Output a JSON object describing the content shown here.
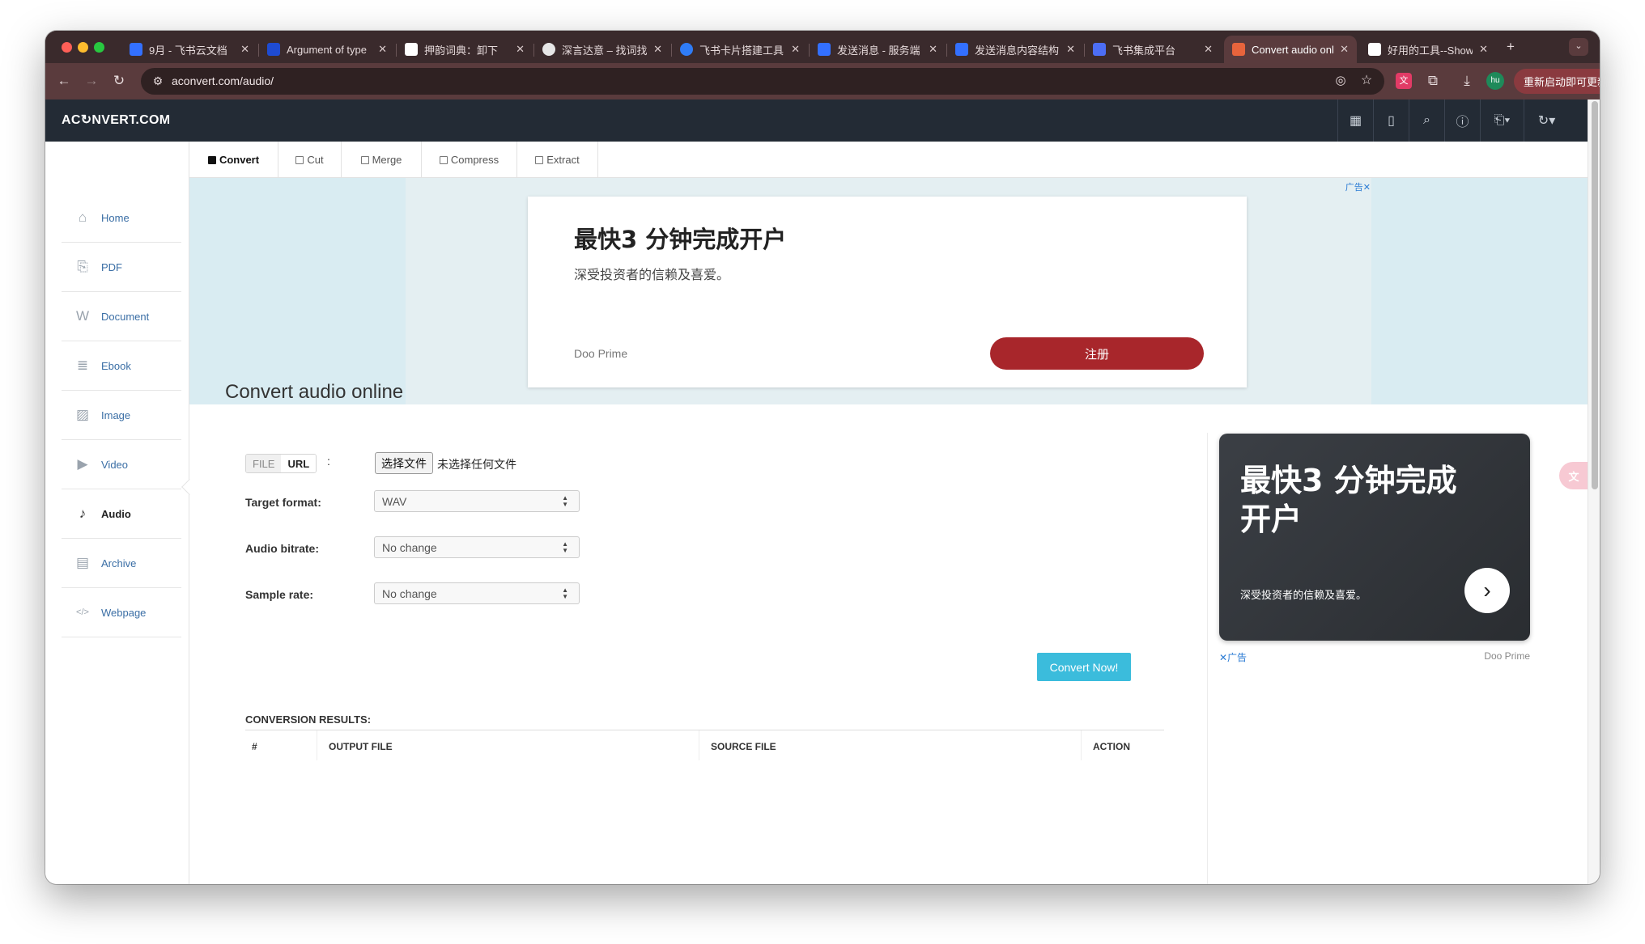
{
  "browser": {
    "tabs": [
      {
        "title": "9月 - 飞书云文档",
        "fav": "#3370ff"
      },
      {
        "title": "Argument of type",
        "fav": "#1e4bd2"
      },
      {
        "title": "押韵词典：卸下",
        "fav": "#ffffff"
      },
      {
        "title": "深言达意 – 找词找",
        "fav": "#e6e6e6"
      },
      {
        "title": "飞书卡片搭建工具",
        "fav": "#2f7cf6"
      },
      {
        "title": "发送消息 - 服务端",
        "fav": "#3370ff"
      },
      {
        "title": "发送消息内容结构",
        "fav": "#3370ff"
      },
      {
        "title": "飞书集成平台",
        "fav": "#4c6ef5"
      },
      {
        "title": "Convert audio onl",
        "fav": "#e8643c"
      },
      {
        "title": "好用的工具--Show",
        "fav": "#ffffff"
      }
    ],
    "url": "aconvert.com/audio/",
    "profile_initials": "hu",
    "restart_label": "重新启动即可更新"
  },
  "site": {
    "logo": "AC↻NVERT.COM"
  },
  "leftmenu": [
    {
      "label": "Home",
      "icon": "home-icon",
      "glyph": "⌂"
    },
    {
      "label": "PDF",
      "icon": "pdf-icon",
      "glyph": "⎘"
    },
    {
      "label": "Document",
      "icon": "document-icon",
      "glyph": "W"
    },
    {
      "label": "Ebook",
      "icon": "ebook-icon",
      "glyph": "≣"
    },
    {
      "label": "Image",
      "icon": "image-icon",
      "glyph": "▨"
    },
    {
      "label": "Video",
      "icon": "video-icon",
      "glyph": "▶"
    },
    {
      "label": "Audio",
      "icon": "audio-icon",
      "glyph": "♪"
    },
    {
      "label": "Archive",
      "icon": "archive-icon",
      "glyph": "▤"
    },
    {
      "label": "Webpage",
      "icon": "webpage-icon",
      "glyph": "</>"
    }
  ],
  "option_tabs": [
    "Convert",
    "Cut",
    "Merge",
    "Compress",
    "Extract"
  ],
  "ad_banner": {
    "headline": "最快3 分钟完成开户",
    "sub": "深受投资者的信赖及喜爱。",
    "brand": "Doo Prime",
    "cta": "注册",
    "mark": "广告✕"
  },
  "main": {
    "title": "Convert audio online",
    "source_tabs": {
      "file": "FILE",
      "url": "URL"
    },
    "colon": ":",
    "choose_file": "选择文件",
    "no_file": "未选择任何文件",
    "target_format_label": "Target format:",
    "target_format_value": "WAV",
    "bitrate_label": "Audio bitrate:",
    "bitrate_value": "No change",
    "sample_rate_label": "Sample rate:",
    "sample_rate_value": "No change",
    "convert_button": "Convert Now!",
    "results_label": "CONVERSION RESULTS:",
    "columns": [
      "#",
      "OUTPUT FILE",
      "SOURCE FILE",
      "ACTION"
    ]
  },
  "side_ad": {
    "headline": "最快3 分钟完成开户",
    "sub": "深受投资者的信赖及喜爱。",
    "mark": "✕广告",
    "brand": "Doo Prime"
  }
}
